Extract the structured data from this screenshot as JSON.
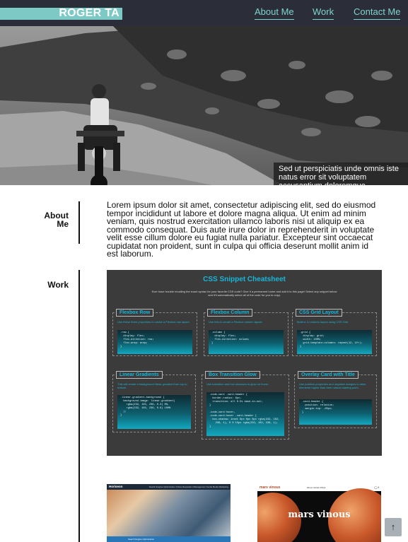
{
  "header": {
    "logo": "ROGER TA",
    "nav": [
      {
        "label": "About Me"
      },
      {
        "label": "Work"
      },
      {
        "label": "Contact Me"
      }
    ]
  },
  "hero": {
    "caption": "Sed ut perspiciatis unde omnis iste natus error sit voluptatem accusantium doloremque laudantium."
  },
  "about": {
    "label": "About Me",
    "text": "Lorem ipsum dolor sit amet, consectetur adipiscing elit, sed do eiusmod tempor incididunt ut labore et dolore magna aliqua. Ut enim ad minim veniam, quis nostrud exercitation ullamco laboris nisi ut aliquip ex ea commodo consequat. Duis aute irure dolor in reprehenderit in voluptate velit esse cillum dolore eu fugiat nulla pariatur. Excepteur sint occaecat cupidatat non proident, sunt in culpa qui officia deserunt mollit anim id est laborum."
  },
  "work": {
    "label": "Work",
    "cheatsheet": {
      "title": "CSS Snippet Cheatsheet",
      "subtitle": "Ever have trouble recalling the exact syntax for your favorite CSS code? Give it a permanent home and add it to this page! Select any snippet below and it'll automatically select all of the code for you to copy.",
      "cards": [
        {
          "title": "Flexbox Row",
          "desc": "Use these three properties to create a Flexbox row layout.",
          "code": ".row {\n  display: flex;\n  flex-direction: row;\n  flex-wrap: wrap;\n}"
        },
        {
          "title": "Flexbox Column",
          "desc": "Use this to create a Flexbox column layout.",
          "code": ".column {\n  display: flex;\n  flex-direction: column;\n}"
        },
        {
          "title": "CSS Grid Layout",
          "desc": "Build a 12 column layout using CSS Grid",
          "code": ".grid {\n  display: grid;\n  width: 100%;\n  grid-template-columns: repeat(12, 1fr);\n}"
        },
        {
          "title": "Linear Gradients",
          "desc": "This will create a background linear gradient from top to bottom.",
          "code": ".linear-gradient-background {\n  background-image: linear-gradient(\n    rgba(232, 102, 236, 0.3) 0%,\n    rgba(232, 102, 236, 0.6) 100%\n  );\n}"
        },
        {
          "title": "Box Transition Glow",
          "desc": "Use transition and box shadows to glow on hover.",
          "code": ".code-card .card-header {\n  border-radius: 8px;\n  transition: all 0.5s ease-in-out;\n}\n\n.code-card:hover,\n.code-card:hover .card-header {\n  box-shadow: inset 0px 0px 8px rgba(232, 102,\n    236, 1), 0 0 15px rgba(232, 102, 236, 1);\n}"
        },
        {
          "title": "Overlay Card with Title",
          "desc": "Use position properties and negative margins to raise elements higher than their natural starting point.",
          "code": ".card-header {\n  position: relative;\n  margin-top: -20px;\n}"
        }
      ]
    },
    "thumbs": [
      {
        "brand": "Horiseon",
        "links": "Search Engine Optimization   Online Reputation Management   Social Media Marketing",
        "footer": "Search Engine Optimization"
      },
      {
        "brand": "mars vinous",
        "links": "about   contact   FAQs",
        "title": "mars vinous"
      }
    ]
  },
  "scroll_top": "↑"
}
